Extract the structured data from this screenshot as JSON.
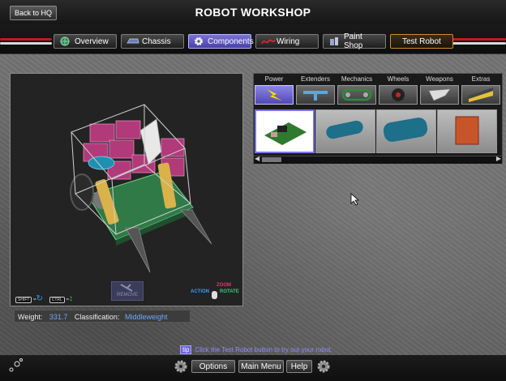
{
  "header": {
    "back_label": "Back to HQ",
    "title": "ROBOT WORKSHOP"
  },
  "tabs": [
    {
      "label": "Overview",
      "icon": "globe-icon"
    },
    {
      "label": "Chassis",
      "icon": "chassis-icon"
    },
    {
      "label": "Components",
      "icon": "gear-icon",
      "active": true
    },
    {
      "label": "Wiring",
      "icon": "wire-icon"
    },
    {
      "label": "Paint Shop",
      "icon": "paint-icon"
    },
    {
      "label": "Test Robot",
      "icon": "none"
    }
  ],
  "viewport": {
    "remove_label": "REMOVE",
    "shift_key": "SHIFT",
    "ctrl_key": "CTRL",
    "zoom_label": "ZOOM",
    "action_label": "ACTION",
    "rotate_label": "ROTATE"
  },
  "info": {
    "weight_label": "Weight:",
    "weight_value": "331.7",
    "class_label": "Classification:",
    "class_value": "Middleweight"
  },
  "categories": [
    {
      "label": "Power",
      "icon": "lightning-icon",
      "active": true
    },
    {
      "label": "Extenders",
      "icon": "extender-icon"
    },
    {
      "label": "Mechanics",
      "icon": "chain-icon"
    },
    {
      "label": "Wheels",
      "icon": "wheel-icon"
    },
    {
      "label": "Weapons",
      "icon": "blade-icon"
    },
    {
      "label": "Extras",
      "icon": "extras-icon"
    }
  ],
  "tip": {
    "badge": "tip",
    "text": "Click the Test Robot button to try out your robot."
  },
  "footer": {
    "options": "Options",
    "main_menu": "Main Menu",
    "help": "Help"
  },
  "colors": {
    "accent": "#6c63d9",
    "test_robot": "#d38a2a",
    "info_value": "#6fa8ff"
  }
}
